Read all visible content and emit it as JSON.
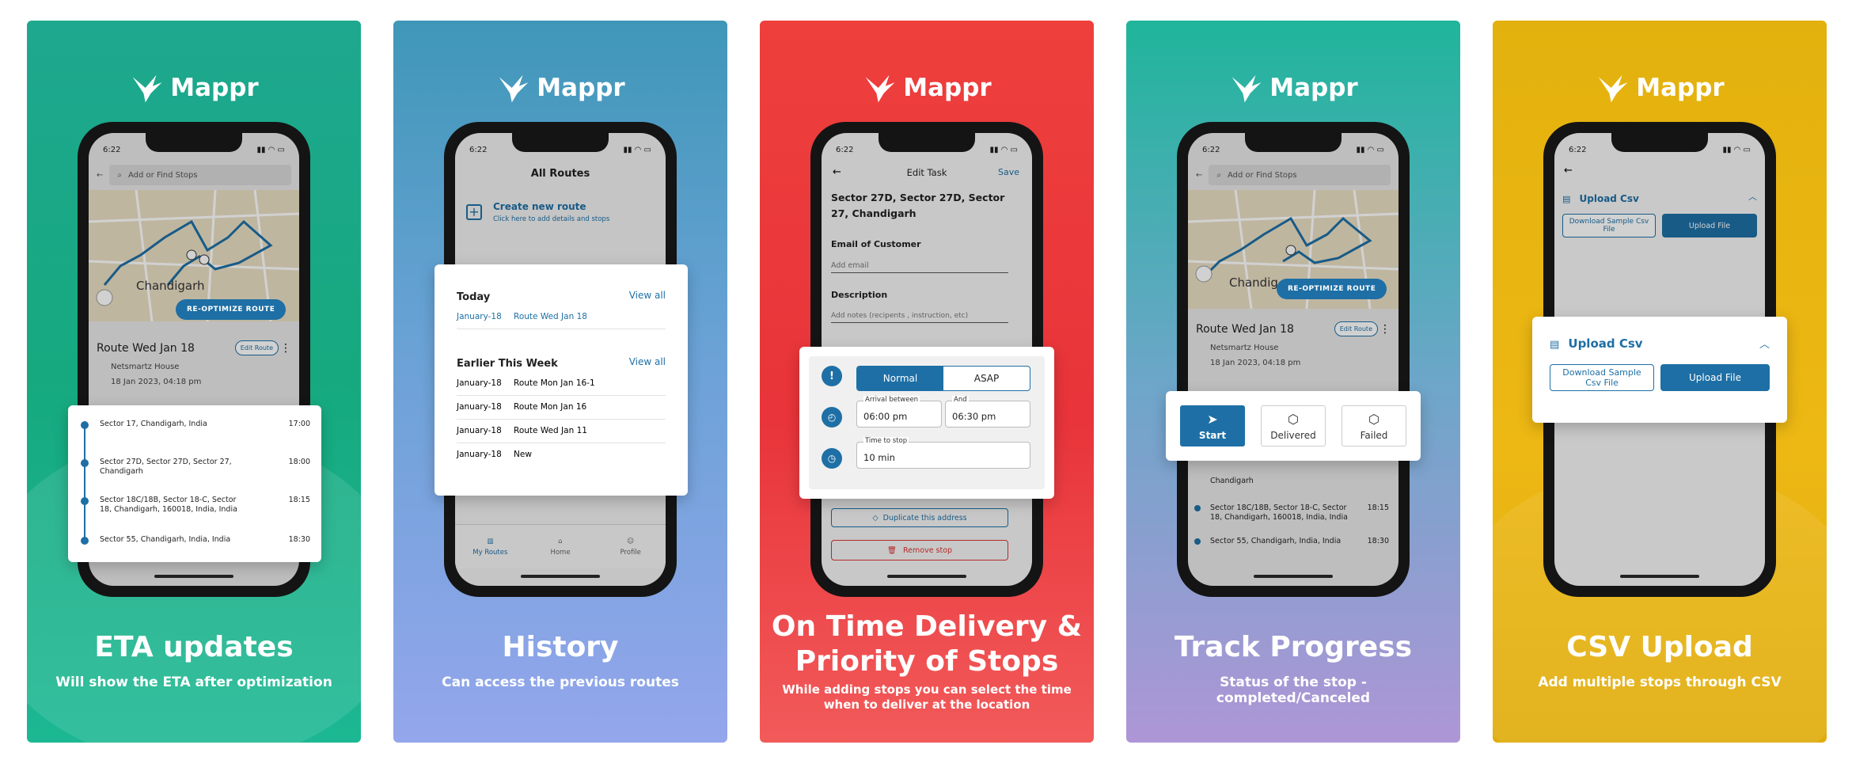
{
  "brand": {
    "name": "Mappr"
  },
  "status_time": "6:22",
  "panels": {
    "eta": {
      "title": "ETA updates",
      "subtitle": "Will show the ETA after optimization",
      "search_placeholder": "Add or Find Stops",
      "map_city": "Chandigarh",
      "reoptimize_label": "RE-OPTIMIZE ROUTE",
      "route_name": "Route Wed Jan 18",
      "edit_route_label": "Edit Route",
      "place": "Netsmartz House",
      "date": "18 Jan 2023, 04:18 pm",
      "stops": [
        {
          "address": "Sector 17, Chandigarh, India",
          "time": "17:00"
        },
        {
          "address": "Sector 27D, Sector 27D, Sector 27, Chandigarh",
          "time": "18:00"
        },
        {
          "address": "Sector 18C/18B, Sector 18-C, Sector 18, Chandigarh, 160018, India, India",
          "time": "18:15"
        },
        {
          "address": "Sector 55, Chandigarh, India, India",
          "time": "18:30"
        }
      ]
    },
    "history": {
      "title": "History",
      "subtitle": "Can access the previous routes",
      "screen_title": "All Routes",
      "create_title": "Create new route",
      "create_sub": "Click here to add details and stops",
      "today_heading": "Today",
      "view_all": "View all",
      "today_rows": [
        {
          "date": "January-18",
          "name": "Route Wed Jan 18"
        }
      ],
      "earlier_heading": "Earlier This Week",
      "earlier_rows": [
        {
          "date": "January-18",
          "name": "Route Mon Jan 16-1"
        },
        {
          "date": "January-18",
          "name": "Route Mon Jan 16"
        },
        {
          "date": "January-18",
          "name": "Route Wed Jan 11"
        },
        {
          "date": "January-18",
          "name": "New"
        }
      ],
      "tabs": [
        "My Routes",
        "Home",
        "Profile"
      ]
    },
    "ontime": {
      "title_line1": "On Time Delivery &",
      "title_line2": "Priority of Stops",
      "subtitle": "While adding stops you can select the time when to deliver at the location",
      "screen_title": "Edit Task",
      "save_label": "Save",
      "address": "Sector 27D, Sector 27D, Sector 27, Chandigarh",
      "email_label": "Email of Customer",
      "email_placeholder": "Add email",
      "desc_label": "Description",
      "desc_placeholder": "Add notes (recipents , instruction, etc)",
      "priority_options": [
        "Normal",
        "ASAP"
      ],
      "arrival_label": "Arrival between",
      "arrival_value": "06:00 pm",
      "and_label": "And",
      "and_value": "06:30 pm",
      "stop_time_label": "Time to stop",
      "stop_time_value": "10 min",
      "duplicate_label": "Duplicate this address",
      "remove_label": "Remove stop"
    },
    "track": {
      "title": "Track Progress",
      "subtitle": "Status of the stop - completed/Canceled",
      "search_placeholder": "Add or Find Stops",
      "map_city": "Chandig",
      "reoptimize_label": "RE-OPTIMIZE ROUTE",
      "route_name": "Route Wed Jan 18",
      "edit_route_label": "Edit Route",
      "place": "Netsmartz House",
      "date": "18 Jan 2023, 04:18 pm",
      "actions": [
        "Start",
        "Delivered",
        "Failed"
      ],
      "partial_stop": "Chandigarh",
      "stops": [
        {
          "address": "Sector 18C/18B, Sector 18-C, Sector 18, Chandigarh, 160018, India, India",
          "time": "18:15"
        },
        {
          "address": "Sector 55, Chandigarh, India, India",
          "time": "18:30"
        }
      ]
    },
    "csv": {
      "title": "CSV Upload",
      "subtitle": "Add multiple stops through CSV",
      "section_title": "Upload Csv",
      "download_label": "Download Sample Csv File",
      "upload_label": "Upload File"
    }
  },
  "colors": {
    "accent": "#1e6fa5",
    "panel_green": "#16a97f",
    "panel_blue": "#6aa2d6",
    "panel_red": "#e8343a",
    "panel_purple": "#ae96d6",
    "panel_yellow": "#edb814"
  }
}
